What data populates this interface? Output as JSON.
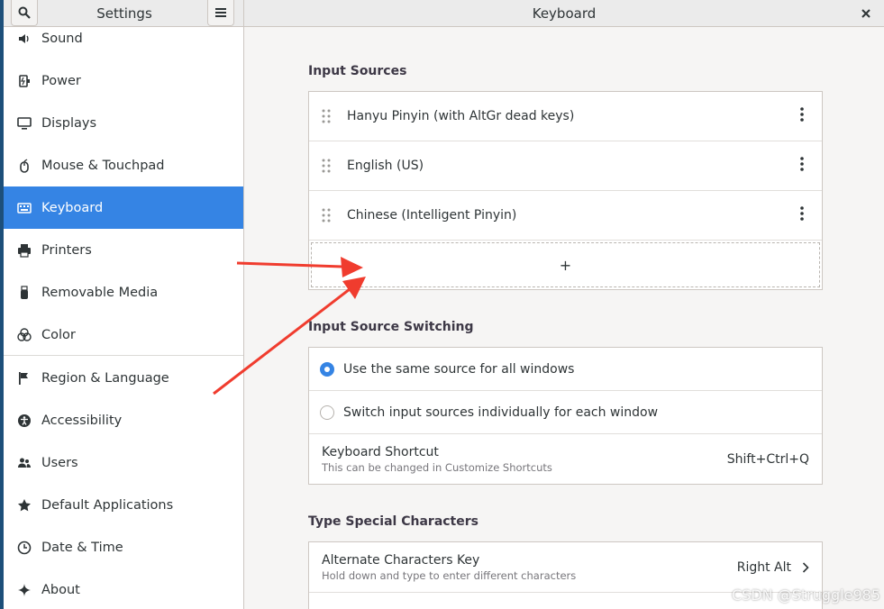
{
  "header": {
    "sidebar_title": "Settings",
    "page_title": "Keyboard",
    "search_icon": "search-icon",
    "menu_icon": "hamburger-menu-icon",
    "close_icon": "close-icon"
  },
  "sidebar": {
    "items": [
      {
        "label": "Sound",
        "icon": "speaker-icon"
      },
      {
        "label": "Power",
        "icon": "power-plug-icon"
      },
      {
        "label": "Displays",
        "icon": "display-icon"
      },
      {
        "label": "Mouse & Touchpad",
        "icon": "mouse-icon"
      },
      {
        "label": "Keyboard",
        "icon": "keyboard-icon",
        "active": true
      },
      {
        "label": "Printers",
        "icon": "printer-icon"
      },
      {
        "label": "Removable Media",
        "icon": "usb-drive-icon"
      },
      {
        "label": "Color",
        "icon": "color-icon"
      },
      {
        "label": "Region & Language",
        "icon": "flag-icon"
      },
      {
        "label": "Accessibility",
        "icon": "accessibility-icon"
      },
      {
        "label": "Users",
        "icon": "users-icon"
      },
      {
        "label": "Default Applications",
        "icon": "star-icon"
      },
      {
        "label": "Date & Time",
        "icon": "clock-icon"
      },
      {
        "label": "About",
        "icon": "sparkle-icon"
      }
    ]
  },
  "input_sources": {
    "title": "Input Sources",
    "items": [
      {
        "label": "Hanyu Pinyin (with AltGr dead keys)"
      },
      {
        "label": "English (US)"
      },
      {
        "label": "Chinese (Intelligent Pinyin)"
      }
    ],
    "add_label": "+"
  },
  "switching": {
    "title": "Input Source Switching",
    "options": [
      {
        "label": "Use the same source for all windows",
        "selected": true
      },
      {
        "label": "Switch input sources individually for each window",
        "selected": false
      }
    ],
    "shortcut": {
      "label": "Keyboard Shortcut",
      "sublabel": "This can be changed in Customize Shortcuts",
      "value": "Shift+Ctrl+Q"
    }
  },
  "special_chars": {
    "title": "Type Special Characters",
    "alt_key": {
      "label": "Alternate Characters Key",
      "sublabel": "Hold down and type to enter different characters",
      "value": "Right Alt"
    }
  },
  "colors": {
    "accent": "#3584e4",
    "annotation_arrow": "#f03c2e"
  },
  "watermark": "CSDN @Struggle985"
}
